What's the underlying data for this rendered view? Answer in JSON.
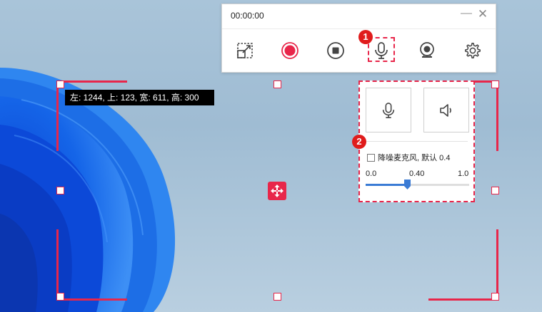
{
  "selection": {
    "coords_label": "左: 1244, 上: 123, 宽: 611, 高: 300"
  },
  "toolbar": {
    "timer": "00:00:00",
    "buttons": [
      {
        "icon": "region-select-icon"
      },
      {
        "icon": "record-icon"
      },
      {
        "icon": "stop-icon"
      },
      {
        "icon": "microphone-icon"
      },
      {
        "icon": "webcam-icon"
      },
      {
        "icon": "settings-gear-icon"
      }
    ]
  },
  "badges": {
    "step1": "1",
    "step2": "2"
  },
  "audio_panel": {
    "noise_reduction_label": "降噪麦克风, 默认 0.4",
    "noise_reduction_checked": false,
    "slider": {
      "min_label": "0.0",
      "value_label": "0.40",
      "max_label": "1.0",
      "min": 0.0,
      "max": 1.0,
      "value": 0.4
    }
  },
  "colors": {
    "accent": "#e8264a",
    "slider": "#3a7bd5",
    "badge": "#e01c1c"
  }
}
